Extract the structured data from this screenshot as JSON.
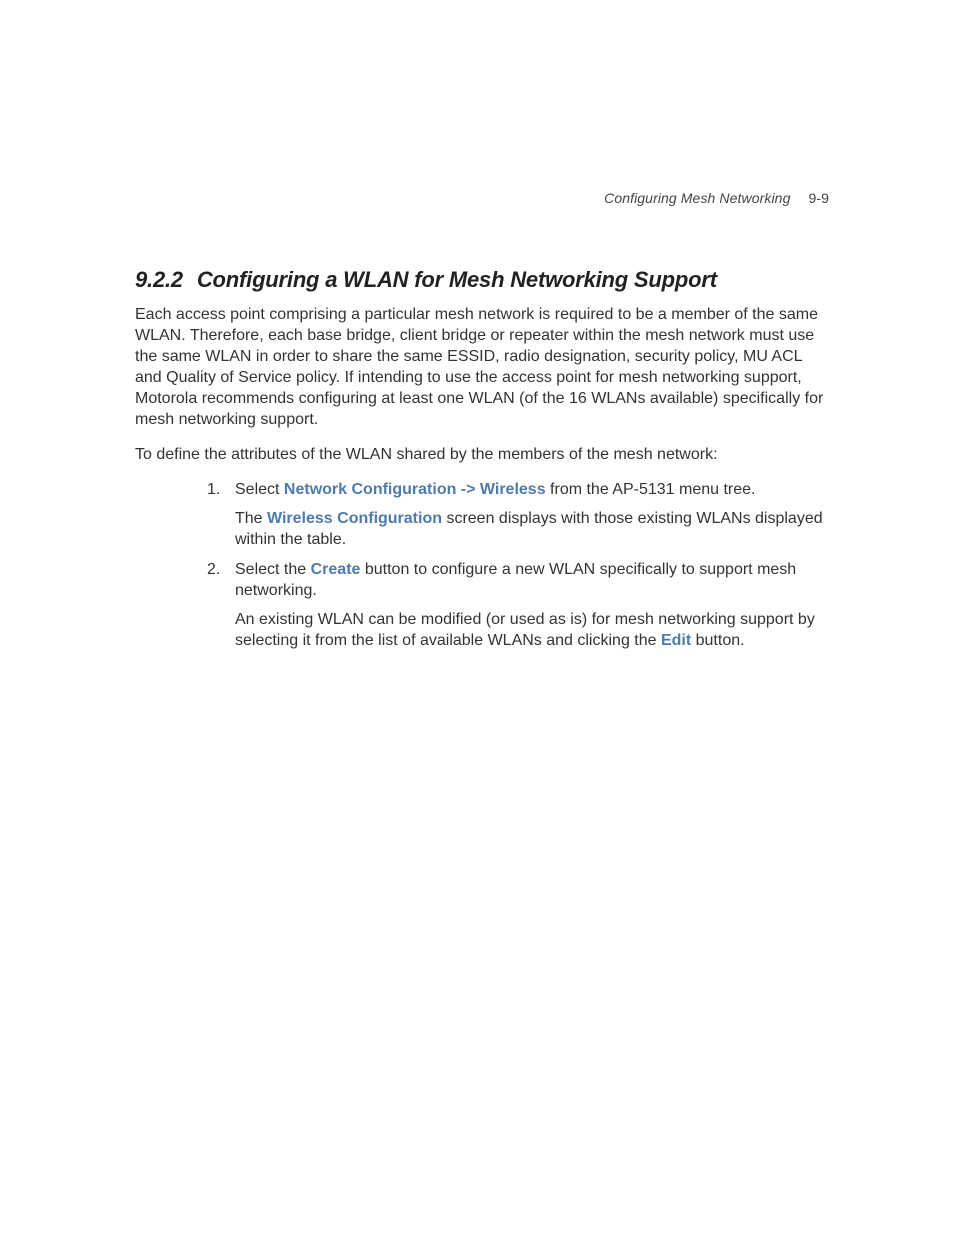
{
  "header": {
    "running_title": "Configuring Mesh Networking",
    "page_ref": "9-9"
  },
  "section": {
    "number": "9.2.2",
    "title": "Configuring a WLAN for Mesh Networking Support"
  },
  "paragraphs": {
    "intro": "Each access point comprising a particular mesh network is required to be a member of the same WLAN. Therefore, each base bridge, client bridge or repeater within the mesh network must use the same WLAN in order to share the same ESSID, radio designation, security policy, MU ACL and Quality of Service policy. If intending to use the access point for mesh networking support, Motorola recommends configuring at least one WLAN (of the 16 WLANs available) specifically for mesh networking support.",
    "lead": "To define the attributes of the WLAN shared by the members of the mesh network:"
  },
  "steps": {
    "s1": {
      "pre": "Select ",
      "kw": "Network Configuration -> Wireless",
      "post": " from the AP-5131 menu tree.",
      "sub": {
        "pre": "The ",
        "kw": "Wireless Configuration",
        "post": " screen displays with those existing WLANs displayed within the table."
      }
    },
    "s2": {
      "pre": "Select the ",
      "kw": "Create",
      "post": " button to configure a new WLAN specifically to support mesh networking.",
      "sub": {
        "pre": "An existing WLAN can be modified (or used as is) for mesh networking support by selecting it from the list of available WLANs and clicking the ",
        "kw": "Edit",
        "post": " button."
      }
    }
  }
}
